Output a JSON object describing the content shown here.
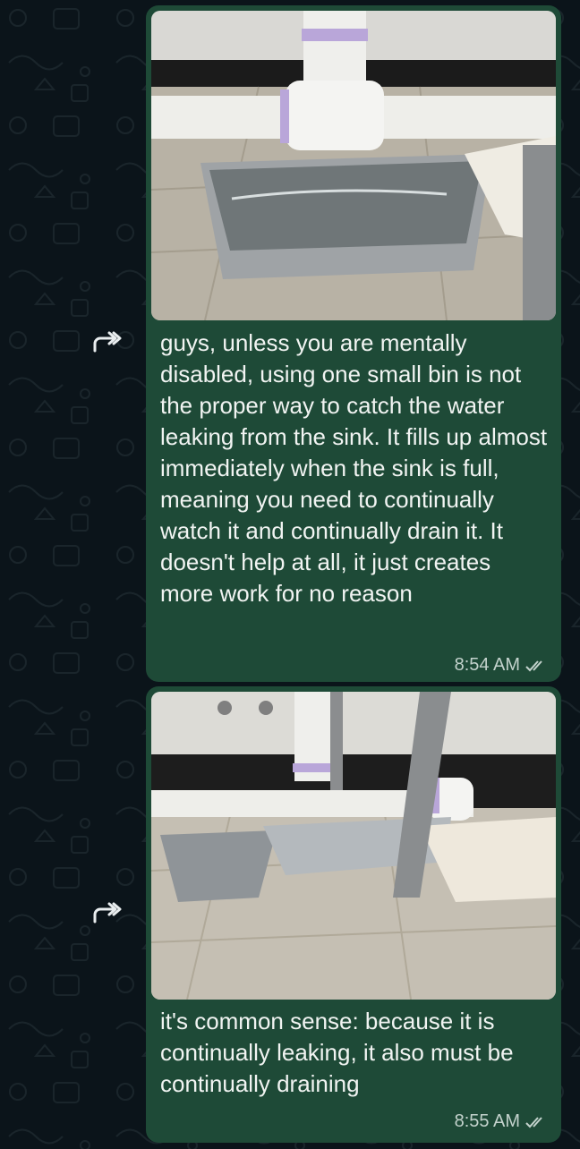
{
  "chat": {
    "messages": [
      {
        "image": {
          "description_icon": "photo-pipe-leak-with-bin"
        },
        "text": "guys, unless you are mentally disabled, using one small bin is not the proper way to catch the water leaking from the sink. It fills up almost immediately when the sink is full, meaning you need to continually watch it and continually drain it. It doesn't help at all, it just creates more work for no reason",
        "time": "8:54 AM",
        "status_icon": "double-check-icon"
      },
      {
        "image": {
          "description_icon": "photo-pipe-with-pans"
        },
        "text": "it's common sense: because it is continually leaking, it also must be continually draining",
        "time": "8:55 AM",
        "status_icon": "double-check-icon"
      }
    ],
    "forward_icon": "forward-icon"
  },
  "colors": {
    "background": "#0b141a",
    "bubble": "#1e4a37",
    "text": "#f1f4f2",
    "meta": "#c3d2cc"
  }
}
